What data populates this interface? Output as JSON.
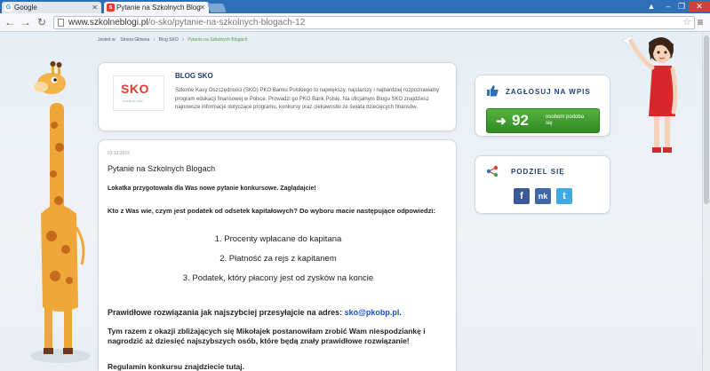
{
  "browser": {
    "tabs": [
      {
        "label": "Google",
        "favicon": "google-favicon",
        "active": false
      },
      {
        "label": "Pytanie na Szkolnych Blog",
        "favicon": "sko-favicon",
        "active": true
      }
    ],
    "close_symbol": "✕",
    "window_controls": {
      "user": "▲",
      "minimize": "–",
      "maximize": "❐",
      "close": "✕"
    },
    "nav": {
      "back": "←",
      "forward": "→",
      "reload": "↻"
    },
    "url_domain": "www.szkolneblogi.pl",
    "url_path": "/o-sko/pytanie-na-szkolnych-blogach-12",
    "star": "☆",
    "menu": "≡"
  },
  "breadcrumb": {
    "prefix": "Jesteś w:",
    "items": [
      "Strona Główna",
      "Blog SKO",
      "Pytanie na Szkolnych Blogach"
    ],
    "separator": "›"
  },
  "blog": {
    "logo_text": "SKO",
    "logo_subtext": "PKO Bank Polski",
    "title": "BLOG SKO",
    "description": "Szkolne Kasy Oszczędności (SKO) PKO Banku Polskiego to największy, najstarszy i najbardziej rozpoznawalny program edukacji finansowej w Polsce. Prowadzi go PKO Bank Polski. Na oficjalnym Blogu SKO znajdziesz najnowsze informacje dotyczące programu, konkursy oraz ciekawostki ze świata dziecięcych finansów."
  },
  "post": {
    "date": "03.12.2015",
    "title": "Pytanie na Szkolnych Blogach",
    "intro": "Lokatka przygotowała dla Was nowe pytanie konkursowe. Zaglądajcie!",
    "question": "Kto z Was wie, czym jest podatek od odsetek kapitałowych? Do wyboru macie następujące odpowiedzi:",
    "answers": [
      "1. Procenty wpłacane do kapitana",
      "2. Płatność za rejs z kapitanem",
      "3. Podatek, który płacony jest od zysków na koncie"
    ],
    "email_text": "Prawidłowe rozwiązania jak najszybciej przesyłajcie na adres: ",
    "email": "sko@pkobp.pl",
    "email_end": ".",
    "promo": "Tym razem z okazji zbliżających się Mikołajek postanowiłam zrobić Wam niespodziankę i nagrodzić aż dziesięć najszybszych osób, które będą znały prawidłowe rozwiązanie!",
    "rules": "Regulamin konkursu znajdziecie tutaj."
  },
  "vote": {
    "title": "ZAGŁOSUJ NA WPIS",
    "arrow": "➜",
    "count": "92",
    "label": "osobom podoba się"
  },
  "share": {
    "title": "PODZIEL SIĘ",
    "buttons": [
      {
        "label": "f",
        "color": "#3b5998",
        "name": "facebook-share-button"
      },
      {
        "label": "nk",
        "color": "#3d67a8",
        "name": "nk-share-button"
      },
      {
        "label": "t",
        "color": "#3fa9e0",
        "name": "twitter-share-button"
      }
    ]
  }
}
